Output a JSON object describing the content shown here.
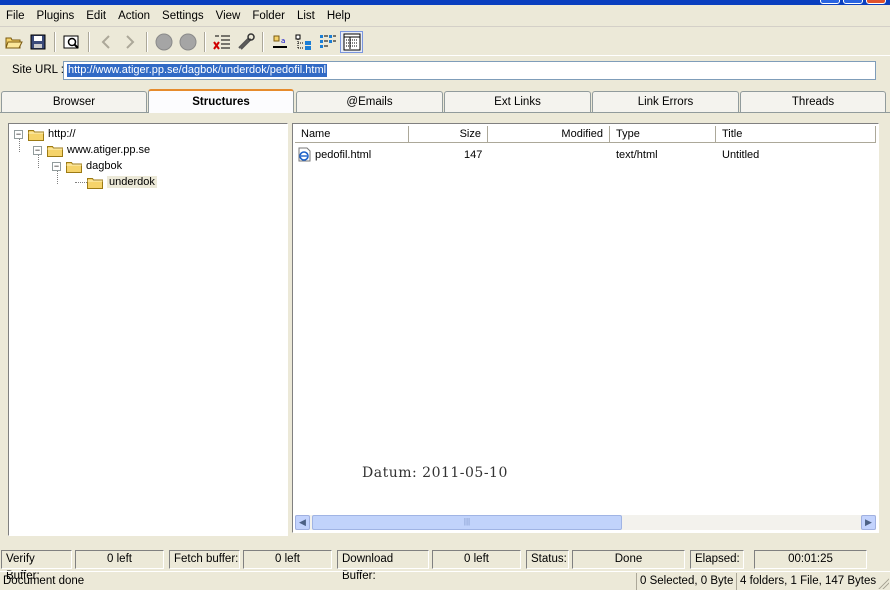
{
  "menu": [
    "File",
    "Plugins",
    "Edit",
    "Action",
    "Settings",
    "View",
    "Folder",
    "List",
    "Help"
  ],
  "url_bar": {
    "label": "Site URL :",
    "value": "http://www.atiger.pp.se/dagbok/underdok/pedofil.html"
  },
  "tabs": {
    "browser": "Browser",
    "structures": "Structures",
    "emails": "@Emails",
    "ext_links": "Ext Links",
    "link_errors": "Link Errors",
    "threads": "Threads"
  },
  "tree": {
    "root": "http://",
    "host": "www.atiger.pp.se",
    "folder1": "dagbok",
    "folder2": "underdok"
  },
  "file_list": {
    "columns": {
      "name": "Name",
      "size": "Size",
      "modified": "Modified",
      "type": "Type",
      "title": "Title"
    },
    "rows": [
      {
        "name": "pedofil.html",
        "size": "147",
        "modified": "",
        "type": "text/html",
        "title": "Untitled"
      }
    ]
  },
  "watermark": "Datum: 2011-05-10",
  "status": {
    "verify_label": "Verify Buffer:",
    "verify_value": "0 left",
    "fetch_label": "Fetch buffer:",
    "fetch_value": "0 left",
    "download_label": "Download Buffer:",
    "download_value": "0 left",
    "status_label": "Status:",
    "status_value": "Done",
    "elapsed_label": "Elapsed:",
    "elapsed_value": "00:01:25"
  },
  "bottom": {
    "message": "Document done",
    "selected": "0 Selected, 0 Byte",
    "summary": "4 folders, 1 File, 147 Bytes"
  },
  "colors": {
    "selection": "#316ac5",
    "tab_accent": "#e68b2c",
    "scrollbar": "#c1d3fb"
  }
}
